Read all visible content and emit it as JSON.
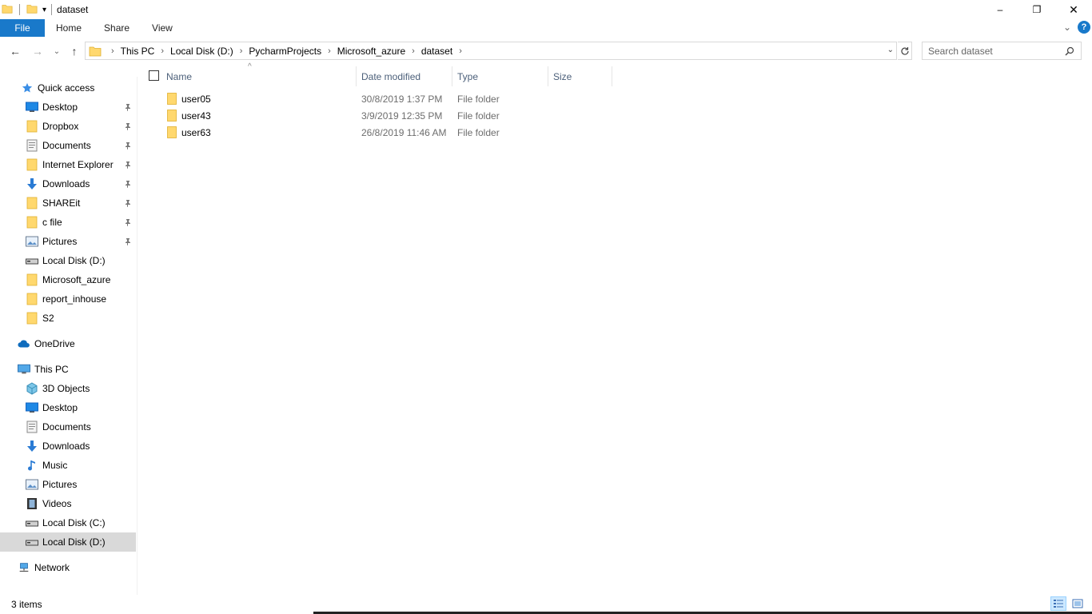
{
  "window": {
    "title": "dataset",
    "minimize_glyph": "–",
    "maximize_glyph": "❐",
    "close_glyph": "✕"
  },
  "ribbon": {
    "tabs": [
      "File",
      "Home",
      "Share",
      "View"
    ],
    "expand_glyph": "⌄",
    "help_glyph": "?"
  },
  "navigation": {
    "back_glyph": "←",
    "forward_glyph": "→",
    "recent_glyph": "⌄",
    "up_glyph": "↑",
    "breadcrumb": [
      "This PC",
      "Local Disk (D:)",
      "PycharmProjects",
      "Microsoft_azure",
      "dataset"
    ],
    "search_placeholder": "Search dataset"
  },
  "sidebar": {
    "items": [
      {
        "label": "Quick access",
        "icon": "star-icon"
      },
      {
        "label": "Desktop",
        "icon": "desktop-icon",
        "pinned": true
      },
      {
        "label": "Dropbox",
        "icon": "folder-icon",
        "pinned": true
      },
      {
        "label": "Documents",
        "icon": "documents-icon",
        "pinned": true
      },
      {
        "label": "Internet Explorer",
        "icon": "folder-icon",
        "pinned": true
      },
      {
        "label": "Downloads",
        "icon": "download-icon",
        "pinned": true
      },
      {
        "label": "SHAREit",
        "icon": "folder-icon",
        "pinned": true
      },
      {
        "label": "c file",
        "icon": "folder-icon",
        "pinned": true
      },
      {
        "label": "Pictures",
        "icon": "pictures-icon",
        "pinned": true
      },
      {
        "label": "Local Disk (D:)",
        "icon": "drive-icon"
      },
      {
        "label": "Microsoft_azure",
        "icon": "folder-icon"
      },
      {
        "label": "report_inhouse",
        "icon": "folder-icon"
      },
      {
        "label": "S2",
        "icon": "folder-icon"
      },
      {
        "label": "OneDrive",
        "icon": "cloud-icon"
      },
      {
        "label": "This PC",
        "icon": "computer-icon"
      },
      {
        "label": "3D Objects",
        "icon": "cube-icon"
      },
      {
        "label": "Desktop",
        "icon": "desktop-icon"
      },
      {
        "label": "Documents",
        "icon": "documents-icon"
      },
      {
        "label": "Downloads",
        "icon": "download-icon"
      },
      {
        "label": "Music",
        "icon": "music-icon"
      },
      {
        "label": "Pictures",
        "icon": "pictures-icon"
      },
      {
        "label": "Videos",
        "icon": "video-icon"
      },
      {
        "label": "Local Disk (C:)",
        "icon": "drive-icon"
      },
      {
        "label": "Local Disk (D:)",
        "icon": "drive-icon",
        "selected": true
      },
      {
        "label": "Network",
        "icon": "network-icon"
      }
    ]
  },
  "file_list": {
    "columns": [
      "Name",
      "Date modified",
      "Type",
      "Size"
    ],
    "rows": [
      {
        "name": "user05",
        "date": "30/8/2019 1:37 PM",
        "type": "File folder",
        "size": ""
      },
      {
        "name": "user43",
        "date": "3/9/2019 12:35 PM",
        "type": "File folder",
        "size": ""
      },
      {
        "name": "user63",
        "date": "26/8/2019 11:46 AM",
        "type": "File folder",
        "size": ""
      }
    ]
  },
  "status": {
    "item_count": "3 items"
  },
  "colors": {
    "accent": "#1979ca",
    "folder": "#ffd86e",
    "header_text": "#4c607a",
    "selected_bg": "#d9d9d9"
  }
}
